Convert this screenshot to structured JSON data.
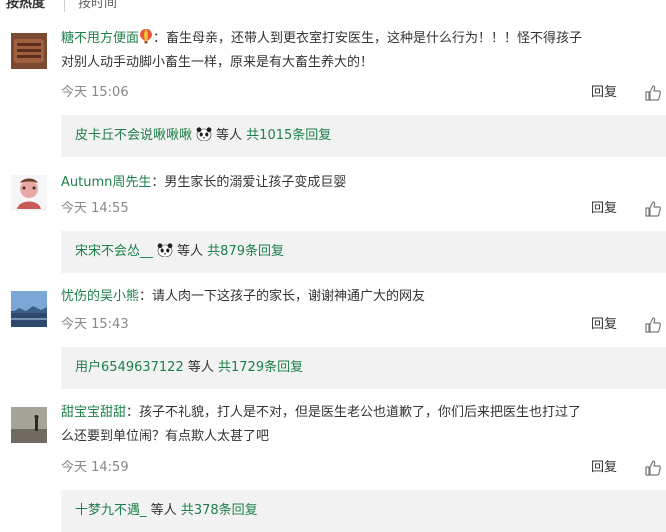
{
  "tabs": {
    "hot": "按热度",
    "time": "按时间"
  },
  "comments": [
    {
      "user": "糖不甩方便面",
      "text_line1": "：畜生母亲，还带人到更衣室打安医生，这种是什么行为！！！怪不得孩子",
      "text_line2": "对别人动手动脚小畜生一样，原来是有大畜生养大的！",
      "time": "今天 15:06",
      "reply": "回复",
      "sub": {
        "user": "皮卡丘不会说啾啾啾",
        "and": "等人",
        "total": "共1015条回复"
      }
    },
    {
      "user": "Autumn周先生",
      "text_line1": "：男生家长的溺爱让孩子变成巨婴",
      "text_line2": "",
      "time": "今天 14:55",
      "reply": "回复",
      "sub": {
        "user": "宋宋不会怂__",
        "and": "等人",
        "total": "共879条回复"
      }
    },
    {
      "user": "忧伤的吴小熊",
      "text_line1": "：请人肉一下这孩子的家长，谢谢神通广大的网友",
      "text_line2": "",
      "time": "今天 15:43",
      "reply": "回复",
      "sub": {
        "user": "用户6549637122",
        "and": "等人",
        "total": "共1729条回复"
      }
    },
    {
      "user": "甜宝宝甜甜",
      "text_line1": "：孩子不礼貌，打人是不对，但是医生老公也道歉了，你们后来把医生也打过了",
      "text_line2": "么还要到单位闹？有点欺人太甚了吧",
      "time": "今天 14:59",
      "reply": "回复",
      "sub": {
        "user": "十梦九不遇_",
        "and": "等人",
        "total": "共378条回复"
      }
    }
  ],
  "colors": {
    "username": "#1d7f4a",
    "text": "#333333",
    "time": "#888888",
    "sub_bg": "#f2f2f2"
  },
  "icons": {
    "like": "thumbs-up-icon",
    "emoji_balloon": "hot-air-balloon-icon",
    "emoji_panda": "panda-icon"
  }
}
